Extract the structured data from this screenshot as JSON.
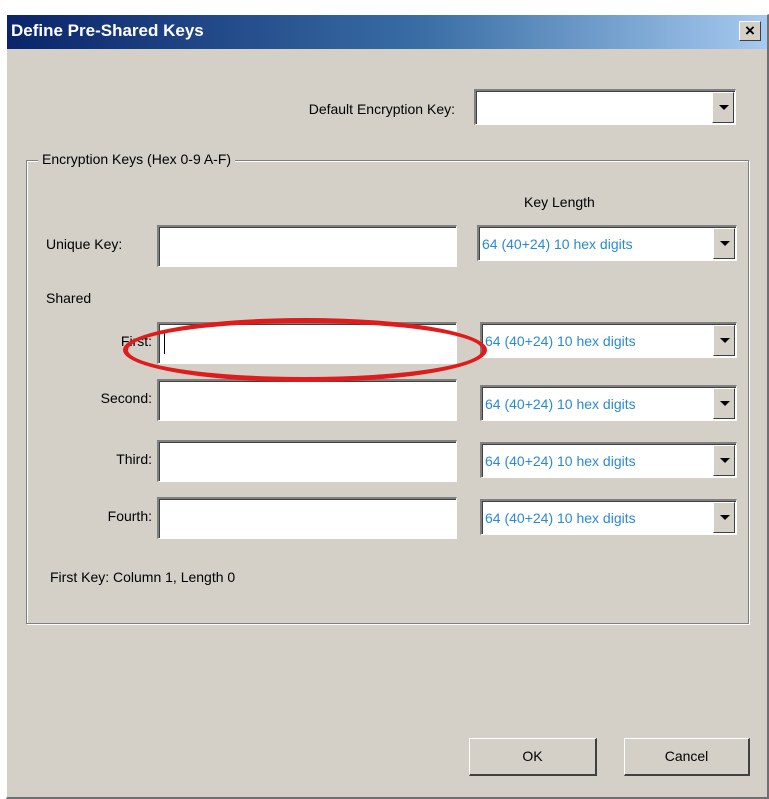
{
  "window": {
    "title": "Define Pre-Shared Keys",
    "close_glyph": "×"
  },
  "default_key": {
    "label": "Default Encryption Key:",
    "value": ""
  },
  "group": {
    "legend": "Encryption Keys (Hex 0-9 A-F)",
    "key_length_header": "Key Length",
    "unique_key_label": "Unique Key:",
    "unique_key_value": "",
    "unique_key_length": "64  (40+24)  10 hex digits",
    "shared_label": "Shared",
    "shared_keys": [
      {
        "label": "First:",
        "value": "",
        "length": "64  (40+24)  10 hex digits"
      },
      {
        "label": "Second:",
        "value": "",
        "length": "64  (40+24)  10 hex digits"
      },
      {
        "label": "Third:",
        "value": "",
        "length": "64  (40+24)  10 hex digits"
      },
      {
        "label": "Fourth:",
        "value": "",
        "length": "64  (40+24)  10 hex digits"
      }
    ],
    "status_text": "First Key: Column 1,  Length 0"
  },
  "buttons": {
    "ok": "OK",
    "cancel": "Cancel"
  },
  "annotation": {
    "color": "#e01b1b"
  },
  "colors": {
    "dialog_bg": "#d4d0c8",
    "combo_text": "#2a8ad0",
    "title_gradient_start": "#0a246a"
  }
}
